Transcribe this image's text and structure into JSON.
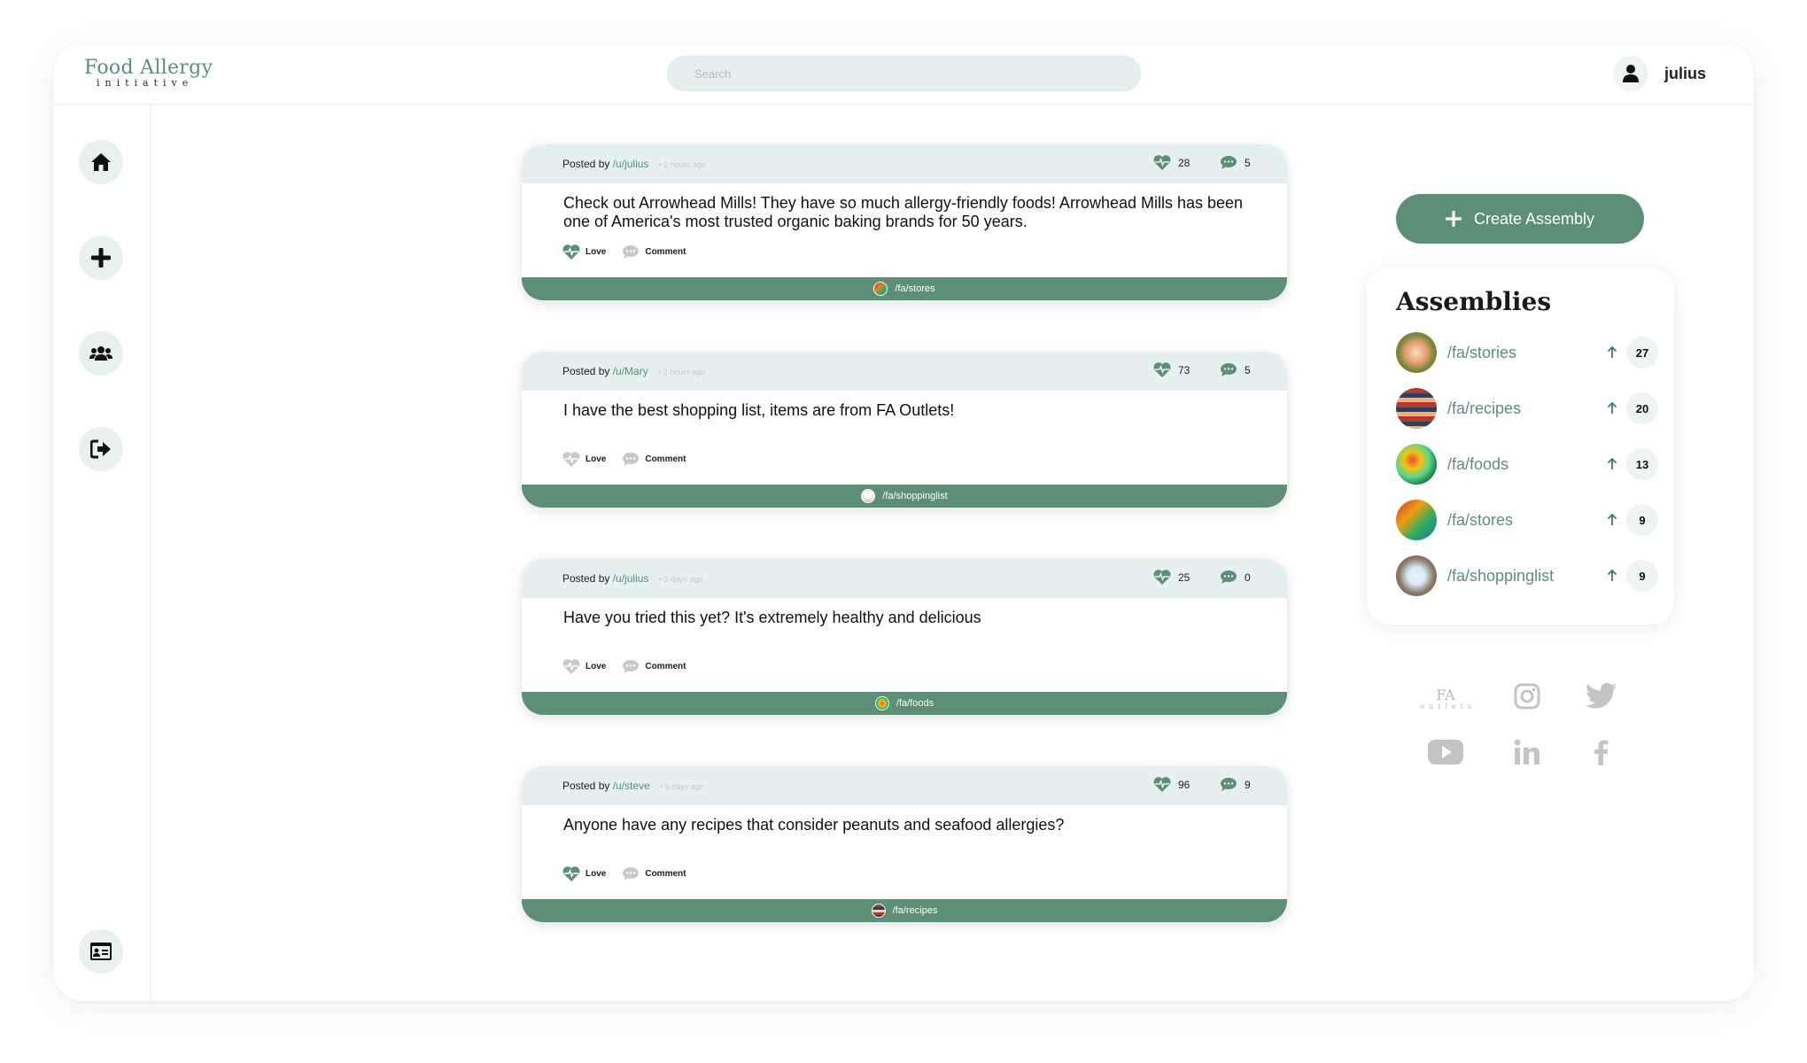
{
  "header": {
    "logo_main": "Food Allergy",
    "logo_sub": "initiative",
    "search_placeholder": "Search",
    "username": "julius"
  },
  "sidebar": {
    "items": [
      {
        "name": "home",
        "icon": "home-icon"
      },
      {
        "name": "create",
        "icon": "plus-icon"
      },
      {
        "name": "community",
        "icon": "users-icon"
      },
      {
        "name": "logout",
        "icon": "logout-icon"
      },
      {
        "name": "profile-card",
        "icon": "id-card-icon"
      }
    ]
  },
  "posts": [
    {
      "posted_by": "Posted by",
      "author": "/u/julius",
      "time": "• 2 hours ago",
      "loves": "28",
      "comments": "5",
      "body": "Check out Arrowhead Mills! They have so much allergy-friendly foods! Arrowhead Mills has been one of America's most trusted organic baking brands for 50 years.",
      "love_label": "Love",
      "comment_label": "Comment",
      "loved": true,
      "assembly": "/fa/stores"
    },
    {
      "posted_by": "Posted by",
      "author": "/u/Mary",
      "time": "• 2 hours ago",
      "loves": "73",
      "comments": "5",
      "body": "I have the best shopping list, items are from FA Outlets!",
      "love_label": "Love",
      "comment_label": "Comment",
      "loved": false,
      "assembly": "/fa/shoppinglist"
    },
    {
      "posted_by": "Posted by",
      "author": "/u/julius",
      "time": "• 3 days ago",
      "loves": "25",
      "comments": "0",
      "body": "Have you tried this yet? It's extremely healthy and delicious",
      "love_label": "Love",
      "comment_label": "Comment",
      "loved": false,
      "assembly": "/fa/foods"
    },
    {
      "posted_by": "Posted by",
      "author": "/u/steve",
      "time": "• 9 days ago",
      "loves": "96",
      "comments": "9",
      "body": "Anyone have any recipes that consider peanuts and seafood allergies?",
      "love_label": "Love",
      "comment_label": "Comment",
      "loved": true,
      "assembly": "/fa/recipes"
    }
  ],
  "create_button": "Create Assembly",
  "assemblies": {
    "title": "Assemblies",
    "items": [
      {
        "name": "/fa/stories",
        "count": "27"
      },
      {
        "name": "/fa/recipes",
        "count": "20"
      },
      {
        "name": "/fa/foods",
        "count": "13"
      },
      {
        "name": "/fa/stores",
        "count": "9"
      },
      {
        "name": "/fa/shoppinglist",
        "count": "9"
      }
    ]
  },
  "social": {
    "fa_outlets_main": "FA",
    "fa_outlets_sub": "outlets",
    "icons": [
      "fa-outlets-logo",
      "instagram-icon",
      "twitter-icon",
      "youtube-icon",
      "linkedin-icon",
      "facebook-icon"
    ]
  },
  "colors": {
    "accent": "#5c8f76",
    "header_tint": "#e7f0f0",
    "icon_inactive": "#c4c4c4"
  }
}
